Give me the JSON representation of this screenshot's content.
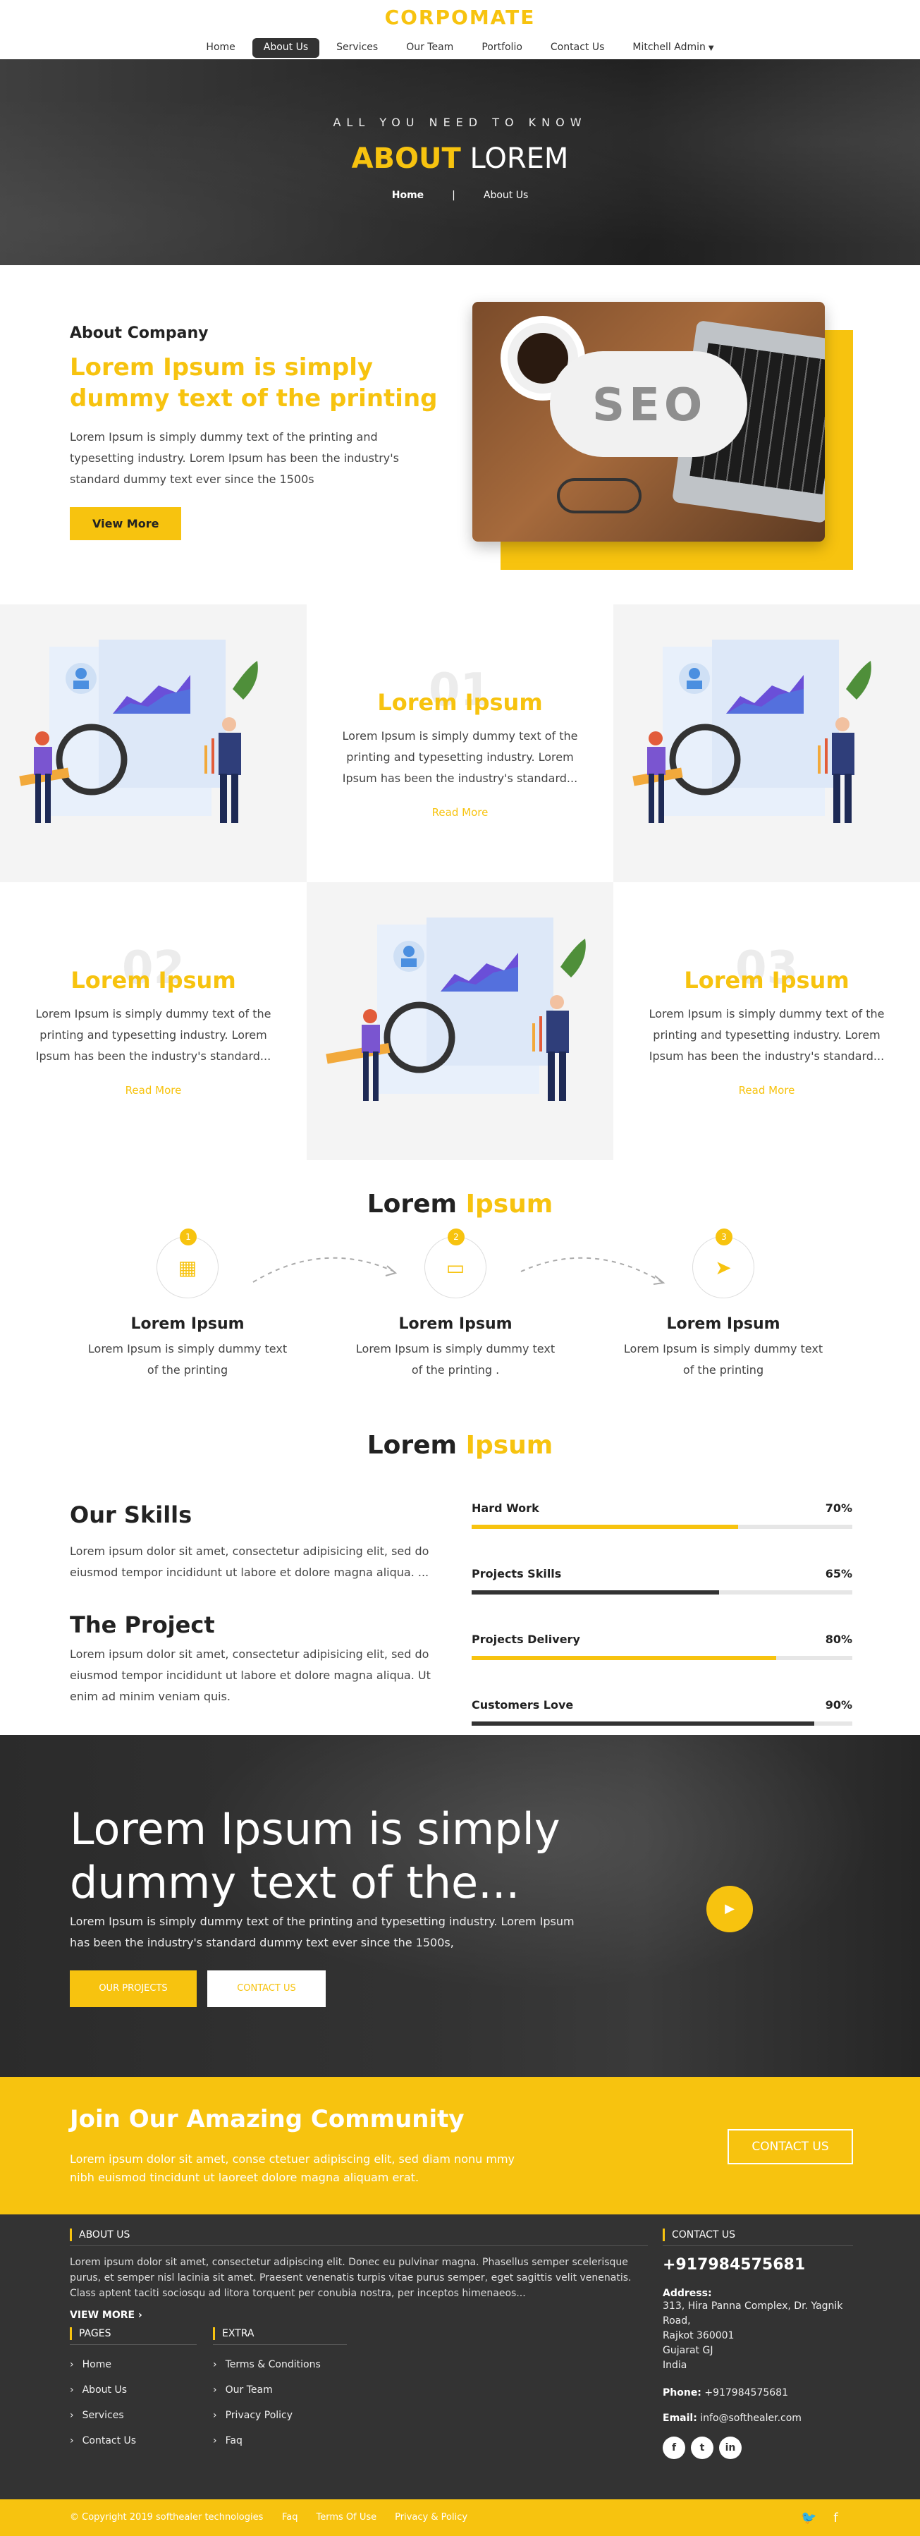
{
  "header": {
    "logo": "CORPOMATE",
    "nav": [
      "Home",
      "About Us",
      "Services",
      "Our Team",
      "Portfolio",
      "Contact Us",
      "Mitchell Admin"
    ],
    "active": "About Us"
  },
  "hero": {
    "tagline": "ALL YOU NEED TO KNOW",
    "title_yellow": "ABOUT",
    "title_white": " LOREM",
    "crumb_home": "Home",
    "crumb_sep": "|",
    "crumb_current": "About Us"
  },
  "about": {
    "small_title": "About Company",
    "headline": "Lorem Ipsum is simply dummy text of the printing",
    "body": "Lorem Ipsum is simply dummy text of the printing and typesetting industry. Lorem Ipsum has been the industry's standard dummy text ever since the 1500s",
    "button": "View More",
    "image_text": "SEO"
  },
  "features": [
    {
      "num": "01",
      "title": "Lorem Ipsum",
      "body": "Lorem Ipsum is simply dummy text of the printing and typesetting industry. Lorem Ipsum has been the industry's standard...",
      "link": "Read More"
    },
    {
      "num": "02",
      "title": "Lorem Ipsum",
      "body": "Lorem Ipsum is simply dummy text of the printing and typesetting industry. Lorem Ipsum has been the industry's standard...",
      "link": "Read More"
    },
    {
      "num": "03",
      "title": "Lorem Ipsum",
      "body": "Lorem Ipsum is simply dummy text of the printing and typesetting industry. Lorem Ipsum has been the industry's standard...",
      "link": "Read More"
    }
  ],
  "process": {
    "title_dark": "Lorem ",
    "title_yellow": "Ipsum",
    "steps": [
      {
        "badge": "1",
        "icon": "calendar-icon",
        "title": "Lorem Ipsum",
        "body": "Lorem Ipsum is simply dummy text of the printing"
      },
      {
        "badge": "2",
        "icon": "folder-icon",
        "title": "Lorem Ipsum",
        "body": "Lorem Ipsum is simply dummy text of the printing ."
      },
      {
        "badge": "3",
        "icon": "paper-plane-icon",
        "title": "Lorem Ipsum",
        "body": "Lorem Ipsum is simply dummy text of the printing"
      }
    ]
  },
  "skills": {
    "title_dark": "Lorem ",
    "title_yellow": "Ipsum",
    "skills_heading": "Our Skills",
    "skills_body": "Lorem ipsum dolor sit amet, consectetur adipisicing elit, sed do eiusmod tempor incididunt ut labore et dolore magna aliqua. ...",
    "project_heading": "The Project",
    "project_body": "Lorem ipsum dolor sit amet, consectetur adipisicing elit, sed do eiusmod tempor incididunt ut labore et dolore magna aliqua. Ut enim ad minim veniam quis.",
    "bars": [
      {
        "label": "Hard Work",
        "value_text": "70%",
        "value": 70,
        "color": "#f7c30f"
      },
      {
        "label": "Projects Skills",
        "value_text": "65%",
        "value": 65,
        "color": "#333333"
      },
      {
        "label": "Projects Delivery",
        "value_text": "80%",
        "value": 80,
        "color": "#f7c30f"
      },
      {
        "label": "Customers Love",
        "value_text": "90%",
        "value": 90,
        "color": "#333333"
      }
    ]
  },
  "promo": {
    "heading": "Lorem Ipsum is simply dummy text of the...",
    "body": "Lorem Ipsum is simply dummy text of the printing and typesetting industry. Lorem Ipsum has been the industry's standard dummy text ever since the 1500s,",
    "btn_projects": "OUR PROJECTS",
    "btn_contact": "CONTACT US"
  },
  "community": {
    "heading": "Join Our Amazing Community",
    "body": "Lorem ipsum dolor sit amet, conse ctetuer adipiscing elit, sed diam nonu mmy nibh euismod tincidunt ut laoreet dolore magna aliquam erat.",
    "button": "CONTACT US"
  },
  "footer": {
    "about_title": "ABOUT US",
    "about_body": "Lorem ipsum dolor sit amet, consectetur adipiscing elit. Donec eu pulvinar magna. Phasellus semper scelerisque purus, et semper nisl lacinia sit amet. Praesent venenatis turpis vitae purus semper, eget sagittis velit venenatis. Class aptent taciti sociosqu ad litora torquent per conubia nostra, per inceptos himenaeos...",
    "view_more": "VIEW MORE  ›",
    "pages_title": "PAGES",
    "pages": [
      "Home",
      "About Us",
      "Services",
      "Contact Us"
    ],
    "extra_title": "EXTRA",
    "extra": [
      "Terms & Conditions",
      "Our Team",
      "Privacy Policy",
      "Faq"
    ],
    "contact_title": "CONTACT US",
    "phone_big": "+917984575681",
    "address_label": "Address:",
    "address": [
      "313, Hira Panna Complex, Dr. Yagnik Road,",
      "Rajkot 360001",
      "Gujarat GJ",
      "India"
    ],
    "phone_label": "Phone:",
    "phone": "+917984575681",
    "email_label": "Email:",
    "email": "info@softhealer.com",
    "socials": [
      "f",
      "t",
      "in"
    ]
  },
  "bottom": {
    "copyright": "© Copyright 2019 softhealer technologies",
    "links": [
      "Faq",
      "Terms Of Use",
      "Privacy & Policy"
    ]
  }
}
